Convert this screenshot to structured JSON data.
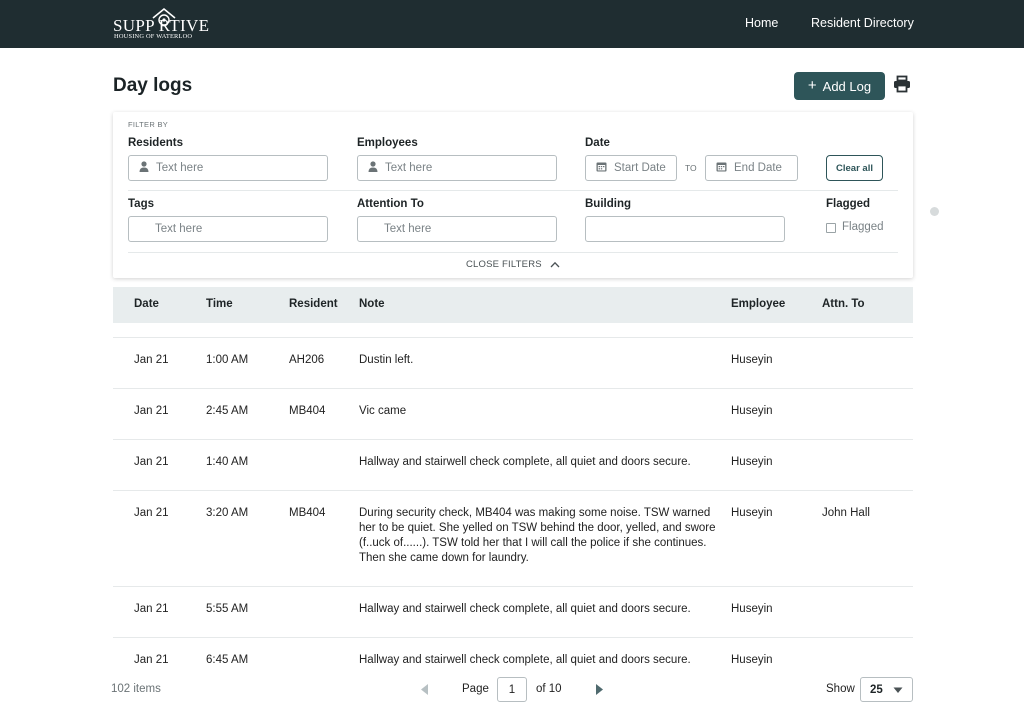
{
  "header": {
    "logo_main": "SUPP  RTIVE",
    "logo_sub": "HOUSING OF WATERLOO",
    "nav": [
      "Home",
      "Resident Directory"
    ],
    "bg_color": "#1f2d31"
  },
  "page": {
    "title": "Day logs",
    "add_button": "Add Log",
    "accent_color": "#2e5559"
  },
  "filters": {
    "section_label": "FILTER BY",
    "residents_label": "Residents",
    "residents_placeholder": "Text here",
    "employees_label": "Employees",
    "employees_placeholder": "Text here",
    "date_label": "Date",
    "start_placeholder": "Start Date",
    "to_label": "TO",
    "end_placeholder": "End Date",
    "clear_label": "Clear all",
    "tags_label": "Tags",
    "tags_placeholder": "Text here",
    "attention_label": "Attention To",
    "attention_placeholder": "Text here",
    "building_label": "Building",
    "building_value": "",
    "flagged_label": "Flagged",
    "flagged_checkbox_label": "Flagged",
    "close_label": "CLOSE FILTERS"
  },
  "table": {
    "columns": [
      "Date",
      "Time",
      "Resident",
      "Note",
      "Employee",
      "Attn. To"
    ],
    "rows": [
      {
        "date": "Jan 21",
        "time": "1:00 AM",
        "resident": "AH206",
        "note": "Dustin left.",
        "employee": "Huseyin",
        "attn": ""
      },
      {
        "date": "Jan 21",
        "time": "2:45 AM",
        "resident": "MB404",
        "note": "Vic came",
        "employee": "Huseyin",
        "attn": ""
      },
      {
        "date": "Jan 21",
        "time": "1:40 AM",
        "resident": "",
        "note": "Hallway and stairwell check complete, all quiet and doors secure.",
        "employee": "Huseyin",
        "attn": ""
      },
      {
        "date": "Jan 21",
        "time": "3:20 AM",
        "resident": "MB404",
        "note": "During security check, MB404 was making some noise. TSW warned her to be quiet. She yelled on TSW behind the door, yelled, and swore (f..uck of......). TSW told her that I will call the police if she continues. Then she came down for laundry.",
        "employee": "Huseyin",
        "attn": "John Hall"
      },
      {
        "date": "Jan 21",
        "time": "5:55 AM",
        "resident": "",
        "note": "Hallway and stairwell check complete, all quiet and doors secure.",
        "employee": "Huseyin",
        "attn": ""
      },
      {
        "date": "Jan 21",
        "time": "6:45 AM",
        "resident": "",
        "note": "Hallway and stairwell check complete, all quiet and doors secure.",
        "employee": "Huseyin",
        "attn": ""
      }
    ]
  },
  "footer": {
    "items_count": "102 items",
    "page_label": "Page",
    "page_value": "1",
    "page_of": "of 10",
    "show_label": "Show",
    "show_value": "25"
  }
}
